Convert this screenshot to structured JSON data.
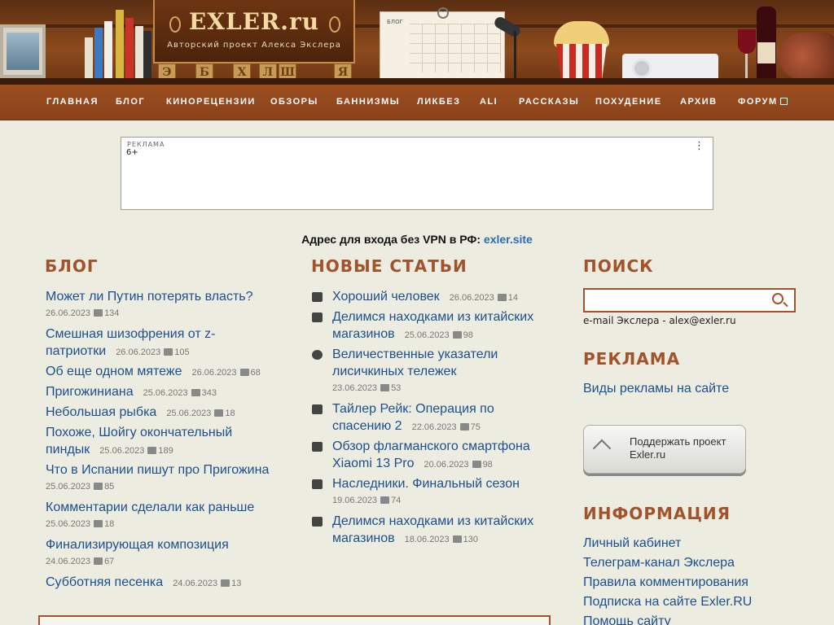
{
  "header": {
    "logo": "EXLER.ru",
    "tagline": "Авторский проект Алекса Экслера",
    "calendar_label": "БЛОГ",
    "blocks": [
      "Э",
      "Б",
      "Х",
      "Л",
      "Ш",
      "Я"
    ]
  },
  "nav": {
    "items": [
      "ГЛАВНАЯ",
      "БЛОГ",
      "КИНОРЕЦЕНЗИИ",
      "ОБЗОРЫ",
      "БАННИЗМЫ",
      "ЛИКБЕЗ",
      "ALI",
      "РАССКАЗЫ",
      "ПОХУДЕНИЕ",
      "АРХИВ",
      "ФОРУМ"
    ]
  },
  "ad": {
    "label": "РЕКЛАМА",
    "age": "6+"
  },
  "vpn": {
    "text": "Адрес для входа без VPN в РФ: ",
    "link": "exler.site"
  },
  "blog": {
    "title": "БЛОГ",
    "posts": [
      {
        "t1": "Может ли Путин потерять власть?",
        "t2": "",
        "date": "26.06.2023",
        "comments": "134"
      },
      {
        "t1": "Смешная шизофрения от z-",
        "t2": "патриотки",
        "date": "26.06.2023",
        "comments": "105"
      },
      {
        "t1": "Об еще одном мятеже",
        "t2": "",
        "date": "26.06.2023",
        "comments": "68"
      },
      {
        "t1": "Пригожиниана",
        "t2": "",
        "date": "25.06.2023",
        "comments": "343"
      },
      {
        "t1": "Небольшая рыбка",
        "t2": "",
        "date": "25.06.2023",
        "comments": "18"
      },
      {
        "t1": "Похоже, Шойгу окончательный",
        "t2": "пиндык",
        "date": "25.06.2023",
        "comments": "189"
      },
      {
        "t1": "Что в Испании пишут про Пригожина",
        "t2": "",
        "date": "25.06.2023",
        "comments": "85"
      },
      {
        "t1": "Комментарии сделали как раньше",
        "t2": "",
        "date": "25.06.2023",
        "comments": "18"
      },
      {
        "t1": "Финализирующая композиция",
        "t2": "",
        "date": "24.06.2023",
        "comments": "67"
      },
      {
        "t1": "Субботняя песенка",
        "t2": "",
        "date": "24.06.2023",
        "comments": "13"
      }
    ]
  },
  "articles": {
    "title": "НОВЫЕ СТАТЬИ",
    "items": [
      {
        "icon": "film-icon",
        "t1": "Хороший человек",
        "t2": "",
        "date": "26.06.2023",
        "comments": "14"
      },
      {
        "icon": "question-icon",
        "t1": "Делимся находками из китайских",
        "t2": "магазинов",
        "date": "25.06.2023",
        "comments": "98"
      },
      {
        "icon": "smile-icon",
        "t1": "Величественные указатели",
        "t2": "лисичкиных тележек",
        "date": "23.06.2023",
        "comments": "53"
      },
      {
        "icon": "film-icon",
        "t1": "Тайлер Рейк: Операция по",
        "t2": "спасению 2",
        "date": "22.06.2023",
        "comments": "75"
      },
      {
        "icon": "review-icon",
        "t1": "Обзор флагманского смартфона",
        "t2": "Xiaomi 13 Pro",
        "date": "20.06.2023",
        "comments": "98"
      },
      {
        "icon": "film-icon",
        "t1": "Наследники. Финальный сезон",
        "t2": "",
        "date": "19.06.2023",
        "comments": "74"
      },
      {
        "icon": "question-icon",
        "t1": "Делимся находками из китайских",
        "t2": "магазинов",
        "date": "18.06.2023",
        "comments": "130"
      }
    ]
  },
  "sidebar": {
    "search_title": "ПОИСК",
    "search_placeholder": "",
    "email": "e-mail Экслера - alex@exler.ru",
    "ads_title": "РЕКЛАМА",
    "ads_link": "Виды рекламы на сайте",
    "support_line1": "Поддержать проект",
    "support_line2": "Exler.ru",
    "info_title": "ИНФОРМАЦИЯ",
    "info_links": [
      "Личный кабинет",
      "Телеграм-канал Экслера",
      "Правила комментирования",
      "Подписка на сайте Exler.RU",
      "Помощь сайту"
    ]
  },
  "colors": {
    "accent": "#a3522a",
    "link": "#1b4f8e",
    "nav": "#8a421a",
    "background": "#edece1"
  }
}
